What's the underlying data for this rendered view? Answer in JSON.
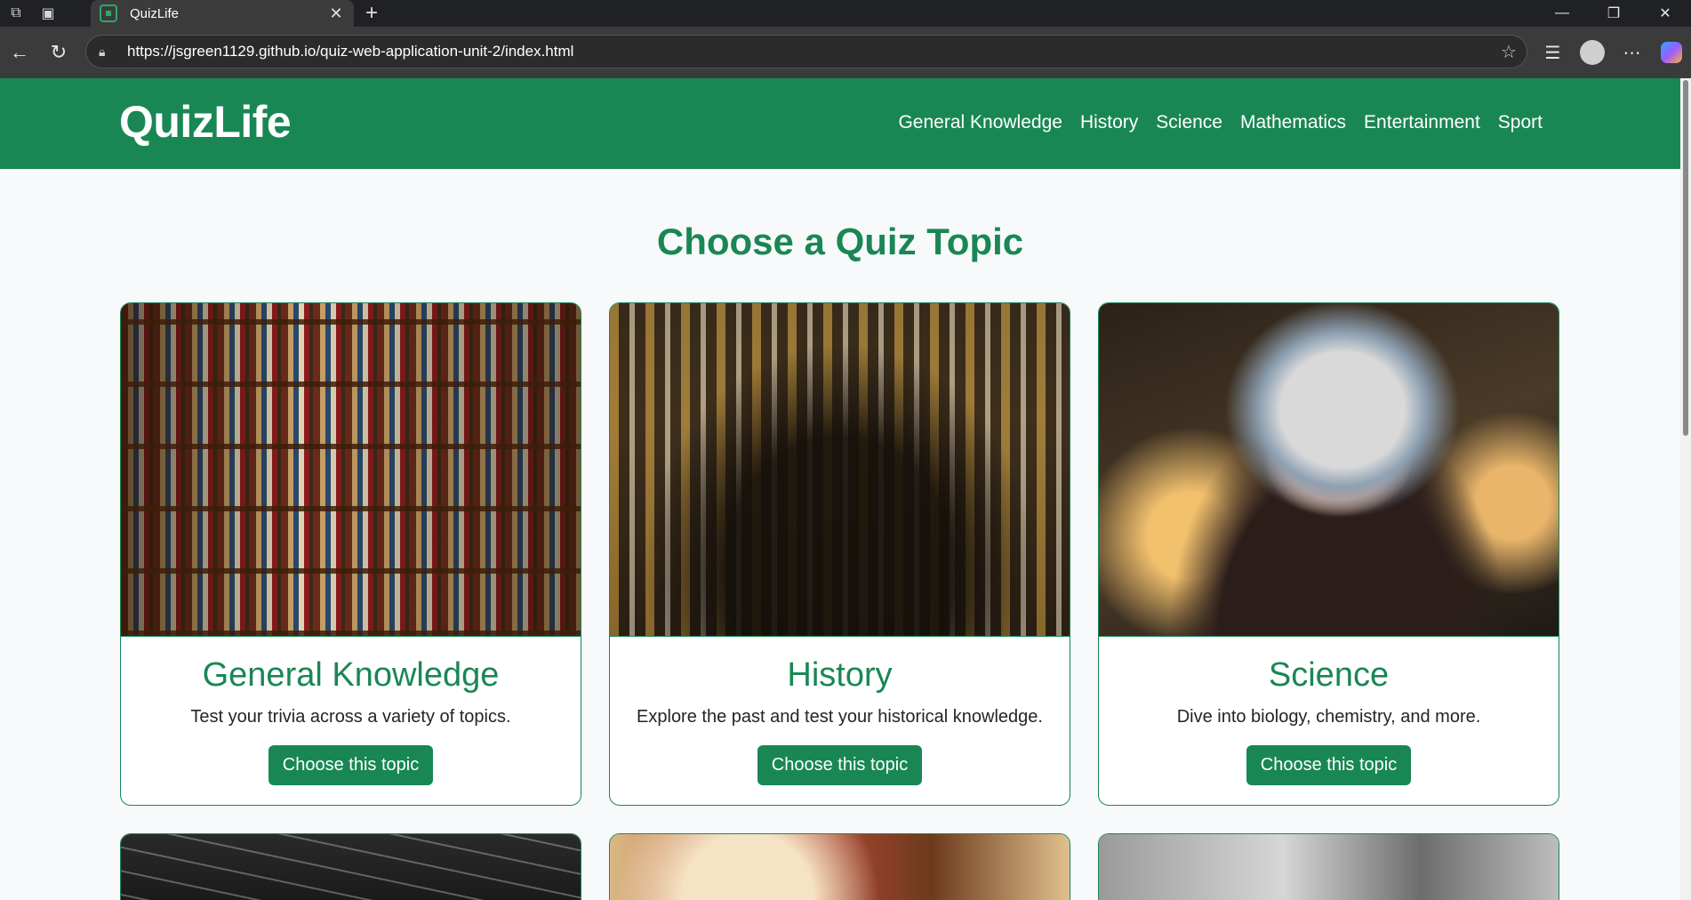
{
  "browser": {
    "tab_title": "QuizLife",
    "url": "https://jsgreen1129.github.io/quiz-web-application-unit-2/index.html"
  },
  "site": {
    "brand": "QuizLife",
    "nav": [
      "General Knowledge",
      "History",
      "Science",
      "Mathematics",
      "Entertainment",
      "Sport"
    ]
  },
  "main": {
    "heading": "Choose a Quiz Topic",
    "cards": [
      {
        "title": "General Knowledge",
        "description": "Test your trivia across a variety of topics.",
        "button": "Choose this topic"
      },
      {
        "title": "History",
        "description": "Explore the past and test your historical knowledge.",
        "button": "Choose this topic"
      },
      {
        "title": "Science",
        "description": "Dive into biology, chemistry, and more.",
        "button": "Choose this topic"
      }
    ]
  },
  "colors": {
    "brand_green": "#198754",
    "page_bg": "#f8f9fa",
    "chrome_dark": "#202124"
  },
  "icons": [
    "workspaces-icon",
    "tab-actions-icon",
    "close-icon",
    "new-tab-icon",
    "minimize-icon",
    "restore-icon",
    "window-close-icon",
    "back-icon",
    "refresh-icon",
    "lock-icon",
    "star-icon",
    "favorites-icon",
    "profile-icon",
    "more-icon",
    "copilot-icon"
  ]
}
